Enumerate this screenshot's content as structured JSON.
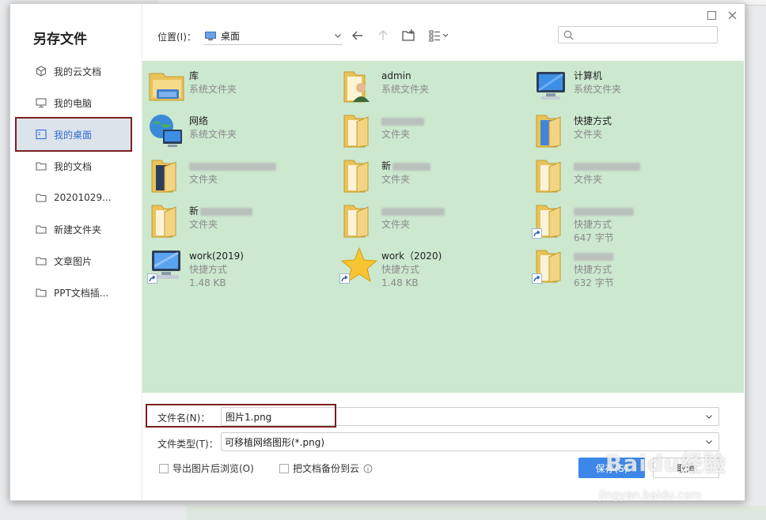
{
  "dialog": {
    "title": "另存文件",
    "window_controls": [
      "maximize-icon",
      "close-icon"
    ]
  },
  "sidebar": {
    "items": [
      {
        "label": "我的云文档",
        "icon": "cloud-doc-icon"
      },
      {
        "label": "我的电脑",
        "icon": "computer-icon"
      },
      {
        "label": "我的桌面",
        "icon": "desktop-icon",
        "selected": true
      },
      {
        "label": "我的文档",
        "icon": "folder-icon"
      },
      {
        "label": "20201029...",
        "icon": "folder-icon"
      },
      {
        "label": "新建文件夹",
        "icon": "folder-icon"
      },
      {
        "label": "文章图片",
        "icon": "folder-icon"
      },
      {
        "label": "PPT文档插...",
        "icon": "folder-icon"
      }
    ]
  },
  "toolbar": {
    "location_label": "位置(I)：",
    "location_value": "桌面",
    "search_placeholder": ""
  },
  "files": [
    {
      "name": "库",
      "type": "系统文件夹",
      "size": "",
      "icon": "library-icon"
    },
    {
      "name": "admin",
      "type": "系统文件夹",
      "size": "",
      "icon": "user-folder-icon"
    },
    {
      "name": "计算机",
      "type": "系统文件夹",
      "size": "",
      "icon": "computer-icon"
    },
    {
      "name": "网络",
      "type": "系统文件夹",
      "size": "",
      "icon": "network-icon"
    },
    {
      "name": "",
      "type": "文件夹",
      "size": "",
      "icon": "folder-icon"
    },
    {
      "name": "快捷方式",
      "type": "文件夹",
      "size": "",
      "icon": "folder-icon"
    },
    {
      "name": "",
      "type": "文件夹",
      "size": "",
      "icon": "folder-icon"
    },
    {
      "name": "新",
      "type": "文件夹",
      "size": "",
      "icon": "folder-icon"
    },
    {
      "name": "",
      "type": "文件夹",
      "size": "",
      "icon": "folder-icon"
    },
    {
      "name": "新",
      "type": "文件夹",
      "size": "",
      "icon": "folder-icon"
    },
    {
      "name": "",
      "type": "文件夹",
      "size": "",
      "icon": "folder-icon"
    },
    {
      "name": "",
      "type": "快捷方式",
      "size": "647 字节",
      "icon": "shortcut-folder-icon"
    },
    {
      "name": "work(2019)",
      "type": "快捷方式",
      "size": "1.48 KB",
      "icon": "shortcut-computer-icon"
    },
    {
      "name": "work（2020)",
      "type": "快捷方式",
      "size": "1.48 KB",
      "icon": "shortcut-star-icon"
    },
    {
      "name": "",
      "type": "快捷方式",
      "size": "632 字节",
      "icon": "shortcut-folder-icon"
    }
  ],
  "form": {
    "filename_label": "文件名(N)：",
    "filename_value": "图片1.png",
    "filetype_label": "文件类型(T)：",
    "filetype_value": "可移植网络图形(*.png)",
    "export_browse_label": "导出图片后浏览(O)",
    "backup_label": "把文档备份到云"
  },
  "buttons": {
    "save": "保存(S)",
    "cancel": "取消"
  },
  "watermark": {
    "brand": "Baidu经验",
    "url": "jingyan.baidu.com"
  },
  "colors": {
    "accent": "#3d87e8",
    "file_area_bg": "#cce8cf",
    "selection_outline": "#7b1f1f"
  }
}
